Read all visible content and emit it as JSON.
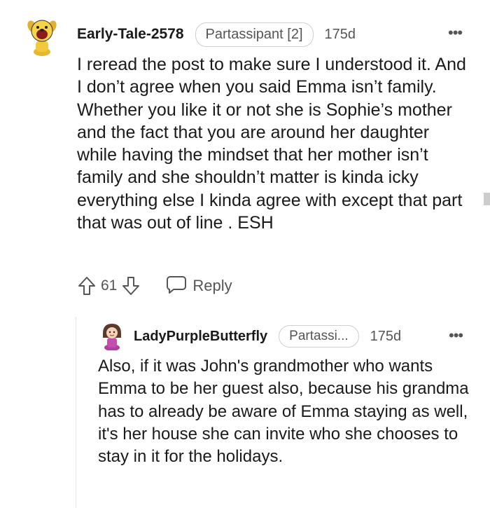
{
  "comment": {
    "username": "Early-Tale-2578",
    "flair": "Partassipant [2]",
    "time": "175d",
    "more": "•••",
    "body": "I reread the post to make sure I understood it. And I don’t agree when you said Emma isn’t family. Whether you like it or not she is Sophie’s mother and the fact that you are around her daughter while having the mindset that her mother isn’t family and she shouldn’t matter is kinda icky everything else I kinda agree with except that part that was out of line . ESH",
    "votes": "61",
    "reply_label": "Reply",
    "icons": {
      "avatar": "dog-avatar-icon",
      "upvote": "upvote-arrow-icon",
      "downvote": "downvote-arrow-icon",
      "reply": "speech-bubble-icon"
    }
  },
  "reply": {
    "username": "LadyPurpleButterfly",
    "flair": "Partassi...",
    "time": "175d",
    "more": "•••",
    "body": "Also, if it was John's grandmother who wants Emma to be her guest also, because his grandma has to already be aware of Emma staying as well, it's her house she can invite who she chooses to stay in it for the holidays.",
    "icons": {
      "avatar": "girl-avatar-icon"
    }
  },
  "colors": {
    "text": "#1a1a1b",
    "muted": "#555555",
    "border": "#cfcfcf"
  }
}
